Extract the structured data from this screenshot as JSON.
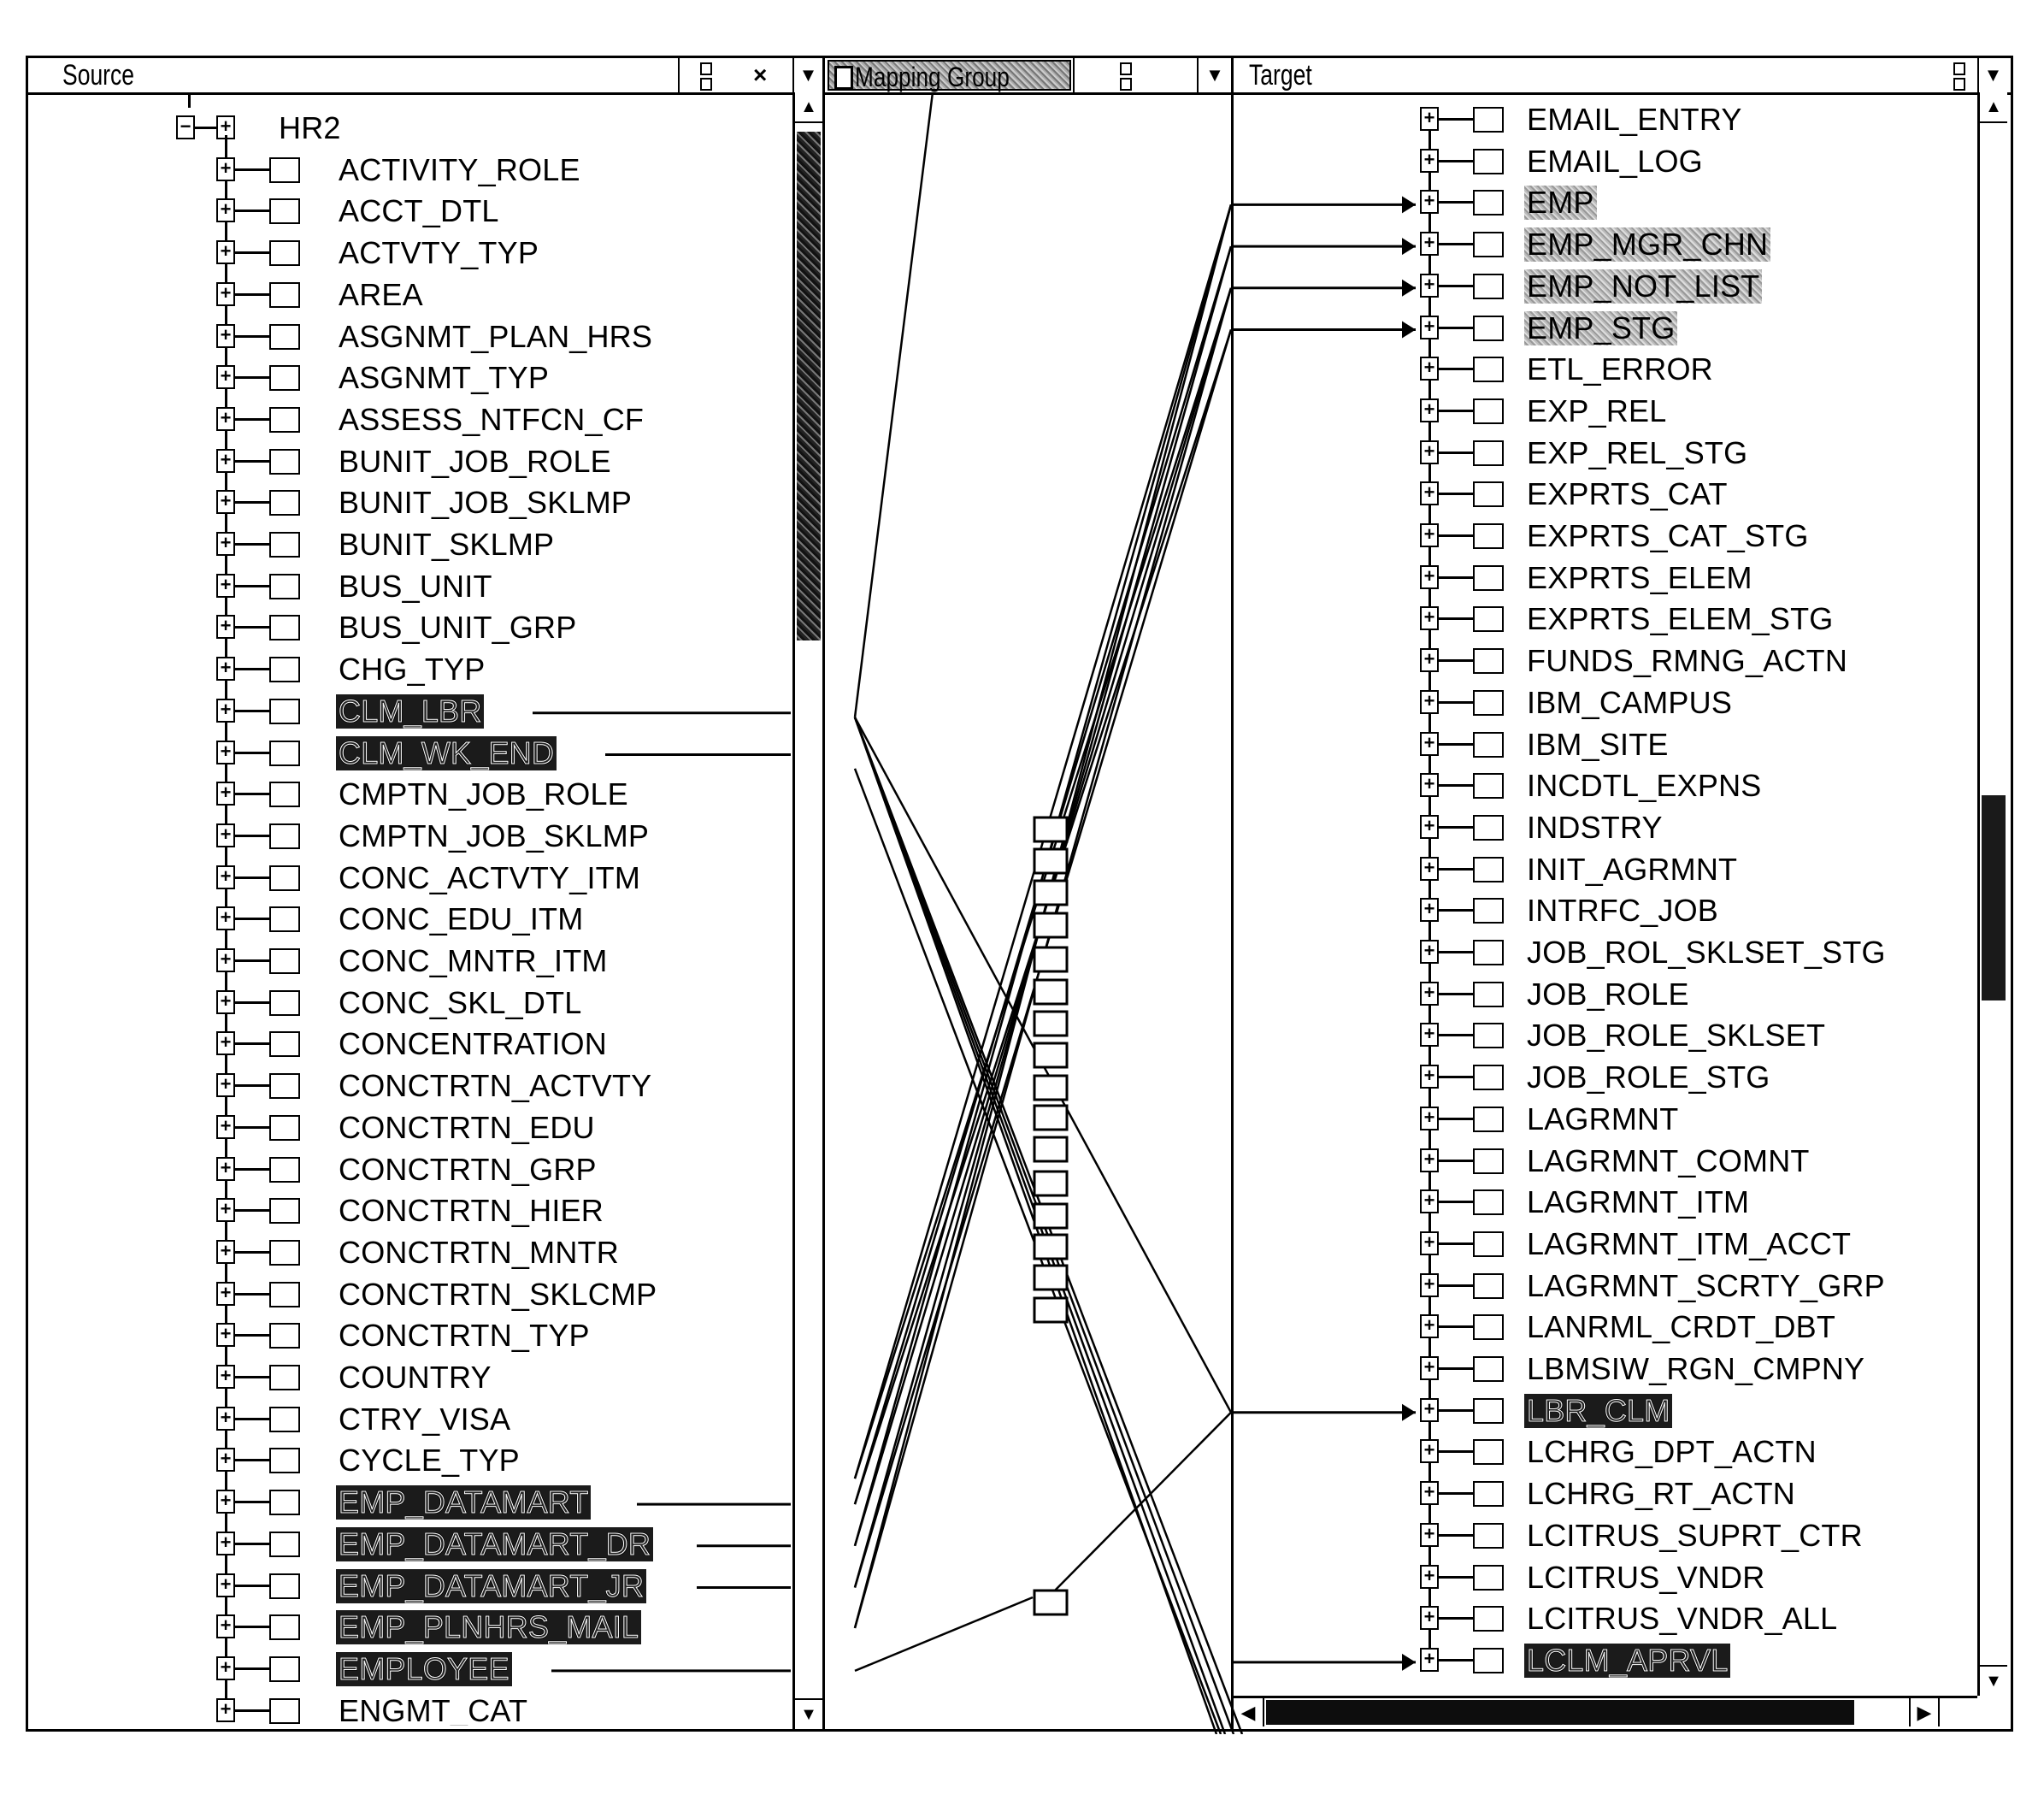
{
  "source_panel": {
    "title": "Source",
    "close_label": "×",
    "root": {
      "label": "HR2",
      "expanded": true
    },
    "items": [
      {
        "label": "ACTIVITY_ROLE",
        "state": "normal"
      },
      {
        "label": "ACCT_DTL",
        "state": "normal"
      },
      {
        "label": "ACTVTY_TYP",
        "state": "normal"
      },
      {
        "label": "AREA",
        "state": "normal"
      },
      {
        "label": "ASGNMT_PLAN_HRS",
        "state": "normal"
      },
      {
        "label": "ASGNMT_TYP",
        "state": "normal"
      },
      {
        "label": "ASSESS_NTFCN_CF",
        "state": "normal"
      },
      {
        "label": "BUNIT_JOB_ROLE",
        "state": "normal"
      },
      {
        "label": "BUNIT_JOB_SKLMP",
        "state": "normal"
      },
      {
        "label": "BUNIT_SKLMP",
        "state": "normal"
      },
      {
        "label": "BUS_UNIT",
        "state": "normal"
      },
      {
        "label": "BUS_UNIT_GRP",
        "state": "normal"
      },
      {
        "label": "CHG_TYP",
        "state": "normal"
      },
      {
        "label": "CLM_LBR",
        "state": "selected",
        "mapped": true
      },
      {
        "label": "CLM_WK_END",
        "state": "selected",
        "mapped": true
      },
      {
        "label": "CMPTN_JOB_ROLE",
        "state": "normal"
      },
      {
        "label": "CMPTN_JOB_SKLMP",
        "state": "normal"
      },
      {
        "label": "CONC_ACTVTY_ITM",
        "state": "normal"
      },
      {
        "label": "CONC_EDU_ITM",
        "state": "normal"
      },
      {
        "label": "CONC_MNTR_ITM",
        "state": "normal"
      },
      {
        "label": "CONC_SKL_DTL",
        "state": "normal"
      },
      {
        "label": "CONCENTRATION",
        "state": "normal"
      },
      {
        "label": "CONCTRTN_ACTVTY",
        "state": "normal"
      },
      {
        "label": "CONCTRTN_EDU",
        "state": "normal"
      },
      {
        "label": "CONCTRTN_GRP",
        "state": "normal"
      },
      {
        "label": "CONCTRTN_HIER",
        "state": "normal"
      },
      {
        "label": "CONCTRTN_MNTR",
        "state": "normal"
      },
      {
        "label": "CONCTRTN_SKLCMP",
        "state": "normal"
      },
      {
        "label": "CONCTRTN_TYP",
        "state": "normal"
      },
      {
        "label": "COUNTRY",
        "state": "normal"
      },
      {
        "label": "CTRY_VISA",
        "state": "normal"
      },
      {
        "label": "CYCLE_TYP",
        "state": "normal"
      },
      {
        "label": "EMP_DATAMART",
        "state": "selected",
        "mapped": true
      },
      {
        "label": "EMP_DATAMART_DR",
        "state": "selected",
        "mapped": true
      },
      {
        "label": "EMP_DATAMART_JR",
        "state": "selected",
        "mapped": true
      },
      {
        "label": "EMP_PLNHRS_MAIL",
        "state": "selected",
        "mapped": false
      },
      {
        "label": "EMPLOYEE",
        "state": "selected",
        "mapped": true
      },
      {
        "label": "ENGMT_CAT",
        "state": "normal"
      }
    ]
  },
  "mapping_panel": {
    "title": "Mapping Group",
    "mapping_node_count": 17
  },
  "target_panel": {
    "title": "Target",
    "items": [
      {
        "label": "EMAIL_ENTRY",
        "state": "normal"
      },
      {
        "label": "EMAIL_LOG",
        "state": "normal"
      },
      {
        "label": "EMP",
        "state": "highlighted",
        "mapped": true
      },
      {
        "label": "EMP_MGR_CHN",
        "state": "highlighted",
        "mapped": true
      },
      {
        "label": "EMP_NOT_LIST",
        "state": "highlighted",
        "mapped": true
      },
      {
        "label": "EMP_STG",
        "state": "highlighted",
        "mapped": true
      },
      {
        "label": "ETL_ERROR",
        "state": "normal"
      },
      {
        "label": "EXP_REL",
        "state": "normal"
      },
      {
        "label": "EXP_REL_STG",
        "state": "normal"
      },
      {
        "label": "EXPRTS_CAT",
        "state": "normal"
      },
      {
        "label": "EXPRTS_CAT_STG",
        "state": "normal"
      },
      {
        "label": "EXPRTS_ELEM",
        "state": "normal"
      },
      {
        "label": "EXPRTS_ELEM_STG",
        "state": "normal"
      },
      {
        "label": "FUNDS_RMNG_ACTN",
        "state": "normal"
      },
      {
        "label": "IBM_CAMPUS",
        "state": "normal"
      },
      {
        "label": "IBM_SITE",
        "state": "normal"
      },
      {
        "label": "INCDTL_EXPNS",
        "state": "normal"
      },
      {
        "label": "INDSTRY",
        "state": "normal"
      },
      {
        "label": "INIT_AGRMNT",
        "state": "normal"
      },
      {
        "label": "INTRFC_JOB",
        "state": "normal"
      },
      {
        "label": "JOB_ROL_SKLSET_STG",
        "state": "normal"
      },
      {
        "label": "JOB_ROLE",
        "state": "normal"
      },
      {
        "label": "JOB_ROLE_SKLSET",
        "state": "normal"
      },
      {
        "label": "JOB_ROLE_STG",
        "state": "normal"
      },
      {
        "label": "LAGRMNT",
        "state": "normal"
      },
      {
        "label": "LAGRMNT_COMNT",
        "state": "normal"
      },
      {
        "label": "LAGRMNT_ITM",
        "state": "normal"
      },
      {
        "label": "LAGRMNT_ITM_ACCT",
        "state": "normal"
      },
      {
        "label": "LAGRMNT_SCRTY_GRP",
        "state": "normal"
      },
      {
        "label": "LANRML_CRDT_DBT",
        "state": "normal"
      },
      {
        "label": "LBMSIW_RGN_CMPNY",
        "state": "normal"
      },
      {
        "label": "LBR_CLM",
        "state": "selected",
        "mapped": true
      },
      {
        "label": "LCHRG_DPT_ACTN",
        "state": "normal"
      },
      {
        "label": "LCHRG_RT_ACTN",
        "state": "normal"
      },
      {
        "label": "LCITRUS_SUPRT_CTR",
        "state": "normal"
      },
      {
        "label": "LCITRUS_VNDR",
        "state": "normal"
      },
      {
        "label": "LCITRUS_VNDR_ALL",
        "state": "normal"
      },
      {
        "label": "LCLM_APRVL",
        "state": "selected",
        "mapped": true
      }
    ]
  },
  "icons": {
    "expand": "+",
    "collapse": "−",
    "dropdown": "▼",
    "scroll_up": "▲",
    "scroll_down": "▼",
    "scroll_left": "◀",
    "scroll_right": "▶"
  }
}
